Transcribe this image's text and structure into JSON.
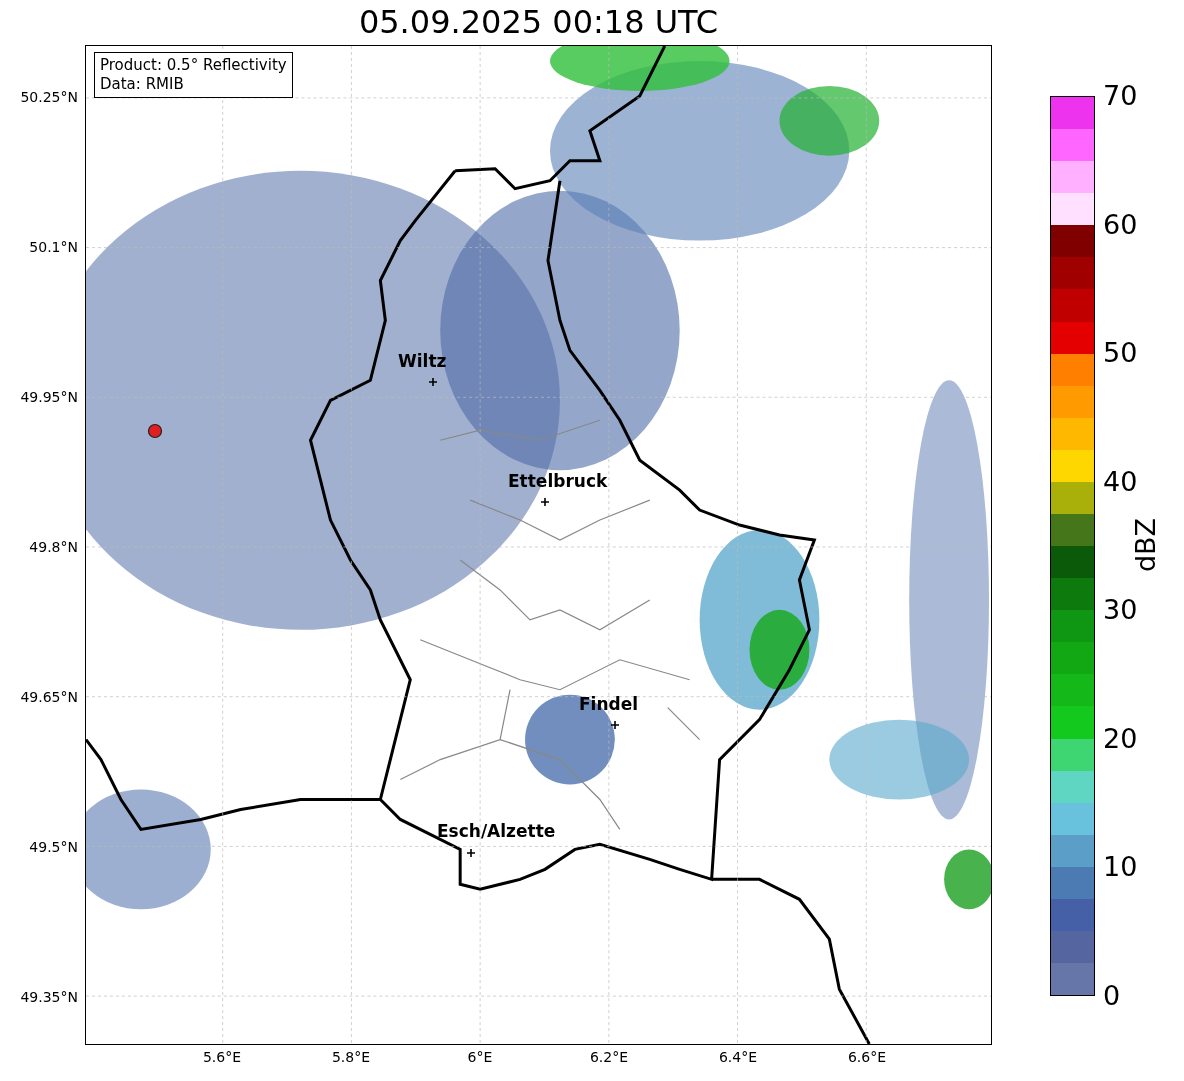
{
  "title": "05.09.2025 00:18 UTC",
  "info_box": [
    "Product: 0.5° Reflectivity",
    "Data: RMIB"
  ],
  "y_ticks": [
    "50.25°N",
    "50.1°N",
    "49.95°N",
    "49.8°N",
    "49.65°N",
    "49.5°N",
    "49.35°N"
  ],
  "x_ticks": [
    "5.6°E",
    "5.8°E",
    "6°E",
    "6.2°E",
    "6.4°E",
    "6.6°E"
  ],
  "places": [
    {
      "name": "Wiltz"
    },
    {
      "name": "Ettelbruck"
    },
    {
      "name": "Findel"
    },
    {
      "name": "Esch/Alzette"
    }
  ],
  "colorbar": {
    "label": "dBZ",
    "ticks": [
      "70",
      "60",
      "50",
      "40",
      "30",
      "20",
      "10",
      "0"
    ],
    "segments": [
      {
        "color": "#ee33ee"
      },
      {
        "color": "#ff66ff"
      },
      {
        "color": "#ffb0ff"
      },
      {
        "color": "#ffe0ff"
      },
      {
        "color": "#800000"
      },
      {
        "color": "#a00000"
      },
      {
        "color": "#c00000"
      },
      {
        "color": "#e40000"
      },
      {
        "color": "#ff7f00"
      },
      {
        "color": "#ff9a00"
      },
      {
        "color": "#ffb800"
      },
      {
        "color": "#ffd700"
      },
      {
        "color": "#aab00a"
      },
      {
        "color": "#46761a"
      },
      {
        "color": "#0a5a0a"
      },
      {
        "color": "#0d7a0e"
      },
      {
        "color": "#0f9612"
      },
      {
        "color": "#12a814"
      },
      {
        "color": "#14b818"
      },
      {
        "color": "#14c91e"
      },
      {
        "color": "#3ed672"
      },
      {
        "color": "#5ed6c2"
      },
      {
        "color": "#68c2de"
      },
      {
        "color": "#5b9fc8"
      },
      {
        "color": "#4b7bb2"
      },
      {
        "color": "#4560a6"
      },
      {
        "color": "#55659f"
      },
      {
        "color": "#6676a8"
      }
    ]
  }
}
